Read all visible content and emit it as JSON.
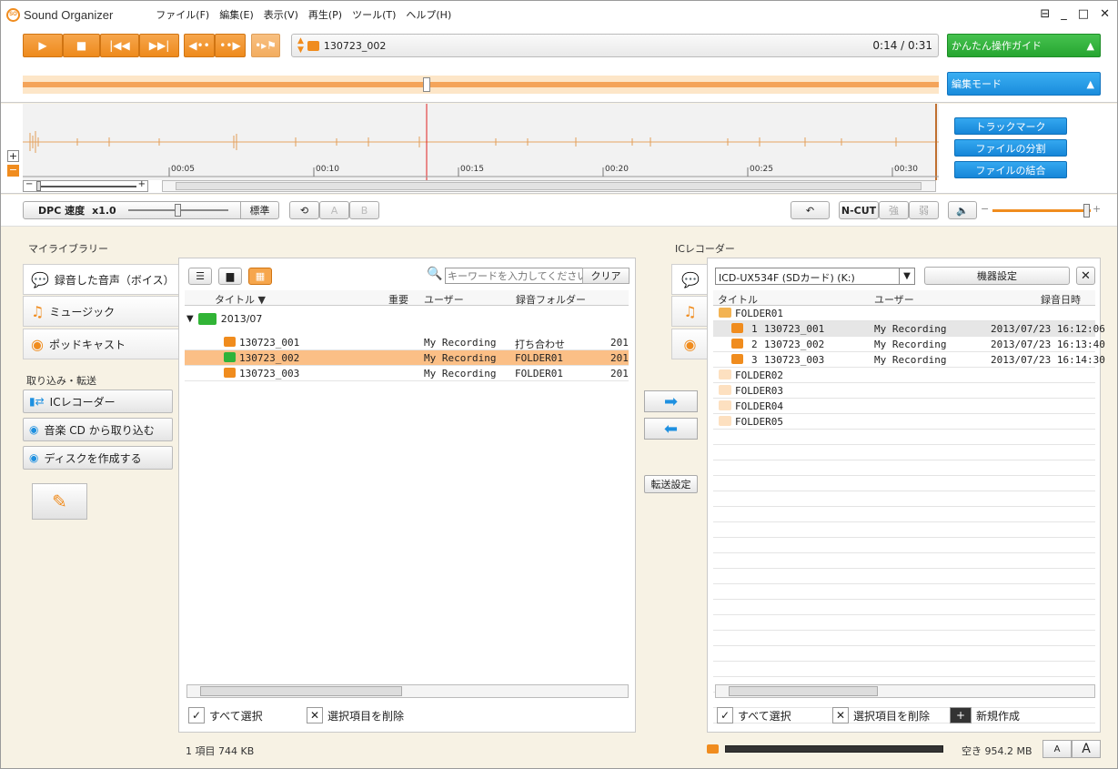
{
  "app": {
    "name": "Sound Organizer"
  },
  "menu": [
    "ファイル(F)",
    "編集(E)",
    "表示(V)",
    "再生(P)",
    "ツール(T)",
    "ヘルプ(H)"
  ],
  "player": {
    "track": "130723_002",
    "time": "0:14 / 0:31"
  },
  "guide": {
    "easy": "かんたん操作ガイド",
    "edit": "編集モード",
    "arrow": "▲"
  },
  "timeline": {
    "ticks": [
      "00:05",
      "00:10",
      "00:15",
      "00:20",
      "00:25",
      "00:30"
    ]
  },
  "edit_buttons": [
    "トラックマーク",
    "ファイルの分割",
    "ファイルの結合"
  ],
  "controls": {
    "dpc": "DPC 速度",
    "speed": "x1.0",
    "standard": "標準",
    "a": "A",
    "b": "B",
    "ncut": "N-CUT",
    "strong": "強",
    "weak": "弱"
  },
  "library": {
    "title": "マイライブラリー",
    "tabs": [
      "録音した音声（ボイス）",
      "ミュージック",
      "ポッドキャスト"
    ],
    "import_title": "取り込み・転送",
    "actions": [
      "ICレコーダー",
      "音楽 CD から取り込む",
      "ディスクを作成する"
    ],
    "search_placeholder": "キーワードを入力してください",
    "clear": "クリア",
    "columns": [
      "タイトル ▼",
      "重要",
      "ユーザー",
      "録音フォルダー"
    ],
    "group": "2013/07",
    "rows": [
      {
        "title": "130723_001",
        "user": "My Recording",
        "folder": "打ち合わせ",
        "date": "201"
      },
      {
        "title": "130723_002",
        "user": "My Recording",
        "folder": "FOLDER01",
        "date": "201"
      },
      {
        "title": "130723_003",
        "user": "My Recording",
        "folder": "FOLDER01",
        "date": "201"
      }
    ],
    "select_all": "すべて選択",
    "delete": "選択項目を削除",
    "status": "1 項目  744 KB"
  },
  "transfer": {
    "settings": "転送設定"
  },
  "recorder": {
    "title": "ICレコーダー",
    "device": "ICD-UX534F (SDカード) (K:)",
    "device_settings": "機器設定",
    "columns": [
      "タイトル",
      "ユーザー",
      "録音日時"
    ],
    "folder1": "FOLDER01",
    "rows": [
      {
        "num": "1",
        "title": "130723_001",
        "user": "My Recording",
        "date": "2013/07/23  16:12:06"
      },
      {
        "num": "2",
        "title": "130723_002",
        "user": "My Recording",
        "date": "2013/07/23  16:13:40"
      },
      {
        "num": "3",
        "title": "130723_003",
        "user": "My Recording",
        "date": "2013/07/23  16:14:30"
      }
    ],
    "folders": [
      "FOLDER02",
      "FOLDER03",
      "FOLDER04",
      "FOLDER05"
    ],
    "select_all": "すべて選択",
    "delete": "選択項目を削除",
    "new": "新規作成",
    "free": "空き 954.2 MB",
    "font_a": "A"
  },
  "colors": {
    "orange": "#ee8a1c",
    "green": "#2fb33a",
    "blue": "#1e90e0",
    "selected": "#fbbf86"
  }
}
